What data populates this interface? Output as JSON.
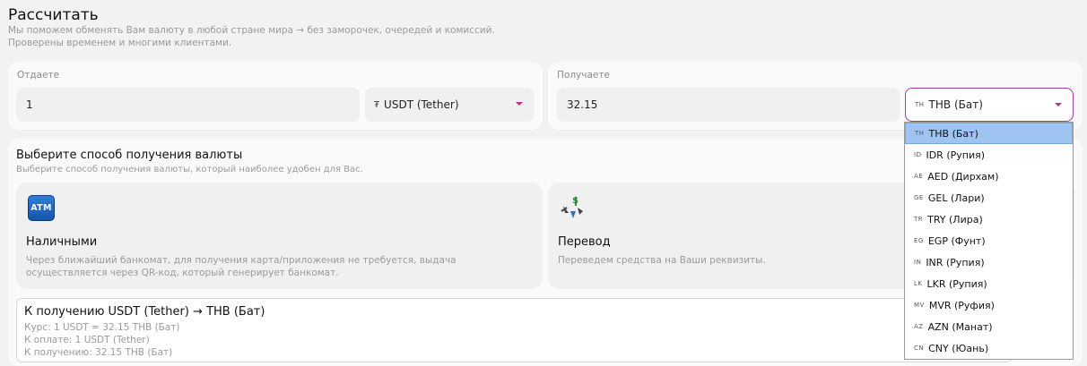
{
  "header": {
    "title": "Рассчитать",
    "subtitle_line1": "Мы поможем обменять Вам валюту в любой стране мира → без заморочек, очередей и комиссий.",
    "subtitle_line2": "Проверены временем и многими клиентами."
  },
  "give": {
    "label": "Отдаете",
    "amount": "1",
    "currency_symbol": "₮",
    "currency": "USDT (Tether)"
  },
  "get": {
    "label": "Получаете",
    "amount": "32.15",
    "currency_flag": "TH",
    "currency": "THB (Бат)"
  },
  "method": {
    "title": "Выберите способ получения валюты",
    "subtitle": "Выберите способ получения валюты, который наиболее удобен для Вас.",
    "cash": {
      "icon_text": "ATM",
      "title": "Наличными",
      "desc": "Через ближайший банкомат, для получения карта/приложения не требуется, выдача осуществляется через QR-код, который генерирует банкомат."
    },
    "transfer": {
      "title": "Перевод",
      "desc": "Переведем средства на Ваши реквизиты."
    }
  },
  "summary": {
    "title": "К получению USDT (Tether) → THB (Бат)",
    "rate": "Курс: 1 USDT = 32.15 THB (Бат)",
    "pay": "К оплате: 1 USDT (Tether)",
    "receive": "К получению: 32.15 THB (Бат)"
  },
  "dropdown": {
    "selected_index": 0,
    "options": [
      {
        "flag": "TH",
        "label": "THB (Бат)"
      },
      {
        "flag": "ID",
        "label": "IDR (Рупия)"
      },
      {
        "flag": "AE",
        "label": "AED (Дирхам)"
      },
      {
        "flag": "GE",
        "label": "GEL (Лари)"
      },
      {
        "flag": "TR",
        "label": "TRY (Лира)"
      },
      {
        "flag": "EG",
        "label": "EGP (Фунт)"
      },
      {
        "flag": "IN",
        "label": "INR (Рупия)"
      },
      {
        "flag": "LK",
        "label": "LKR (Рупия)"
      },
      {
        "flag": "MV",
        "label": "MVR (Руфия)"
      },
      {
        "flag": "AZ",
        "label": "AZN (Манат)"
      },
      {
        "flag": "CN",
        "label": "CNY (Юань)"
      }
    ]
  },
  "colors": {
    "accent": "#b0339b",
    "selected_bg": "#9fc4f2"
  }
}
